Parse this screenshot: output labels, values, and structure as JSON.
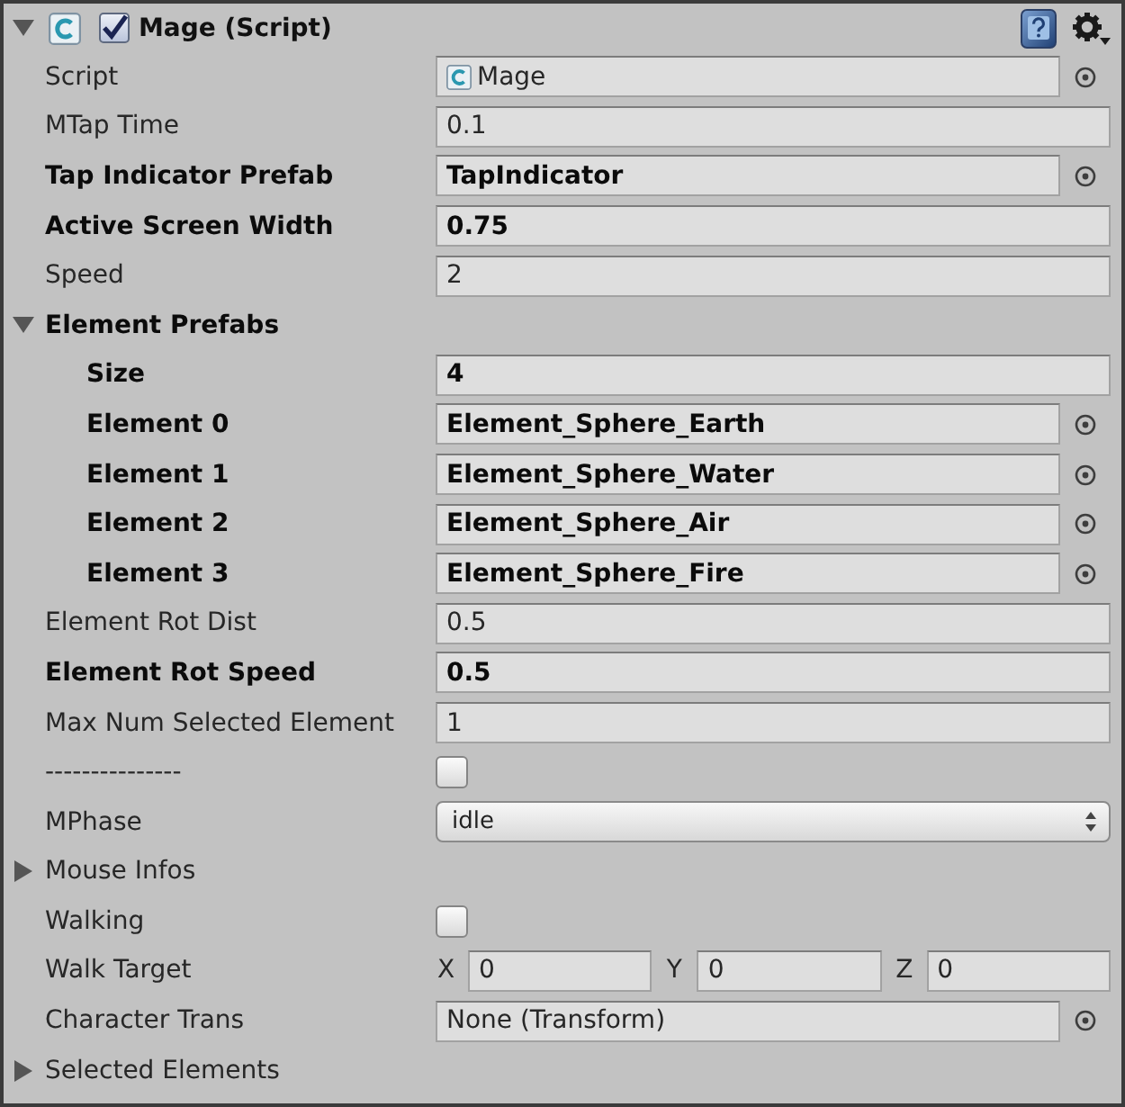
{
  "component": {
    "title": "Mage (Script)",
    "expanded": true,
    "enabled": true
  },
  "properties": [
    {
      "kind": "script",
      "label": "Script",
      "value": "Mage",
      "modified": false
    },
    {
      "kind": "field",
      "label": "MTap Time",
      "value": "0.1",
      "modified": false
    },
    {
      "kind": "object",
      "label": "Tap Indicator Prefab",
      "value": "TapIndicator",
      "modified": true
    },
    {
      "kind": "field",
      "label": "Active Screen Width",
      "value": "0.75",
      "modified": true
    },
    {
      "kind": "field",
      "label": "Speed",
      "value": "2",
      "modified": false
    },
    {
      "kind": "foldout",
      "label": "Element Prefabs",
      "expanded": true,
      "modified": true,
      "children": [
        {
          "kind": "field",
          "label": "Size",
          "value": "4",
          "modified": true
        },
        {
          "kind": "object",
          "label": "Element 0",
          "value": "Element_Sphere_Earth",
          "modified": true
        },
        {
          "kind": "object",
          "label": "Element 1",
          "value": "Element_Sphere_Water",
          "modified": true
        },
        {
          "kind": "object",
          "label": "Element 2",
          "value": "Element_Sphere_Air",
          "modified": true
        },
        {
          "kind": "object",
          "label": "Element 3",
          "value": "Element_Sphere_Fire",
          "modified": true
        }
      ]
    },
    {
      "kind": "field",
      "label": "Element Rot Dist",
      "value": "0.5",
      "modified": false
    },
    {
      "kind": "field",
      "label": "Element Rot Speed",
      "value": "0.5",
      "modified": true
    },
    {
      "kind": "field",
      "label": "Max Num Selected Element",
      "value": "1",
      "modified": false
    },
    {
      "kind": "checkbox",
      "label": "---------------",
      "checked": false,
      "modified": false
    },
    {
      "kind": "enum",
      "label": "MPhase",
      "value": "idle",
      "modified": false
    },
    {
      "kind": "foldout",
      "label": "Mouse Infos",
      "expanded": false,
      "modified": false
    },
    {
      "kind": "checkbox",
      "label": "Walking",
      "checked": false,
      "modified": false
    },
    {
      "kind": "vector3",
      "label": "Walk Target",
      "modified": false,
      "components": [
        {
          "axis": "X",
          "value": "0"
        },
        {
          "axis": "Y",
          "value": "0"
        },
        {
          "axis": "Z",
          "value": "0"
        }
      ]
    },
    {
      "kind": "object",
      "label": "Character Trans",
      "value": "None (Transform)",
      "modified": false
    },
    {
      "kind": "foldout",
      "label": "Selected Elements",
      "expanded": false,
      "modified": false
    }
  ]
}
